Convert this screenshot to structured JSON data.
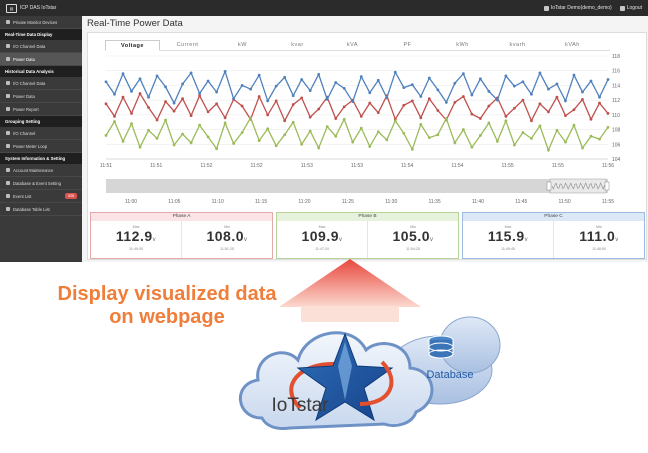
{
  "header": {
    "app_title": "ICP DAS IoTstar",
    "user": "IoTstar Demo(demo_demo)",
    "logout": "Logout"
  },
  "sidebar": {
    "items": [
      {
        "kind": "item",
        "label": "Private Monitor Devices",
        "active": false
      },
      {
        "kind": "head",
        "label": "Real-Time Data Display"
      },
      {
        "kind": "item",
        "label": "I/O Channel Data",
        "active": false
      },
      {
        "kind": "item",
        "label": "Power Data",
        "active": true
      },
      {
        "kind": "head",
        "label": "Historical Data Analysis"
      },
      {
        "kind": "item",
        "label": "I/O Channel Data",
        "active": false
      },
      {
        "kind": "item",
        "label": "Power Data",
        "active": false
      },
      {
        "kind": "item",
        "label": "Power Report",
        "active": false
      },
      {
        "kind": "head",
        "label": "Grouping Setting"
      },
      {
        "kind": "item",
        "label": "I/O Channel",
        "active": false
      },
      {
        "kind": "item",
        "label": "Power Meter Loop",
        "active": false
      },
      {
        "kind": "head",
        "label": "System Information & Setting"
      },
      {
        "kind": "item",
        "label": "Account Maintenance",
        "active": false
      },
      {
        "kind": "item",
        "label": "Database & Event Setting",
        "active": false
      },
      {
        "kind": "item",
        "label": "Event List",
        "active": false,
        "badge": "925"
      },
      {
        "kind": "item",
        "label": "Database Table List",
        "active": false
      }
    ]
  },
  "page": {
    "title": "Real-Time Power Data"
  },
  "tabs": [
    "Voltage",
    "Current",
    "kW",
    "kvar",
    "kVA",
    "PF",
    "kWh",
    "kvarh",
    "kVAh"
  ],
  "chart_data": {
    "type": "line",
    "y_ticks": [
      104,
      106,
      108,
      110,
      112,
      114,
      116,
      118
    ],
    "ylim": [
      104,
      118
    ],
    "x_ticks": [
      "11:51",
      "11:51",
      "11:52",
      "11:52",
      "11:53",
      "11:53",
      "11:54",
      "11:54",
      "11:55",
      "11:55",
      "11:56"
    ],
    "navigator_ticks": [
      "11:00",
      "11:05",
      "11:10",
      "11:15",
      "11:20",
      "11:25",
      "11:30",
      "11:35",
      "11:40",
      "11:45",
      "11:50",
      "11:55"
    ],
    "series": [
      {
        "name": "Phase A",
        "color": "#c0504d",
        "values": [
          111.5,
          109.8,
          112.4,
          110.2,
          112.9,
          111.0,
          109.3,
          111.8,
          110.5,
          112.2,
          109.9,
          112.6,
          110.4,
          111.5,
          109.6,
          112.1,
          111.2,
          109.4,
          112.5,
          110.0,
          111.9,
          109.2,
          111.4,
          112.3,
          109.7,
          110.8,
          112.4,
          109.5,
          111.1,
          112.0,
          109.8,
          111.6,
          110.3,
          112.6,
          109.4,
          111.3,
          111.9,
          109.6,
          112.2,
          110.6,
          109.3,
          111.7,
          112.5,
          110.1,
          109.5,
          111.2,
          112.3,
          109.8,
          110.9,
          112.0,
          109.2,
          111.5,
          110.4,
          112.4,
          109.9,
          110.7,
          112.1,
          109.4,
          111.6,
          110.2
        ]
      },
      {
        "name": "Phase B",
        "color": "#9bbb59",
        "values": [
          107.2,
          109.1,
          106.4,
          108.8,
          105.6,
          107.9,
          106.8,
          109.3,
          105.9,
          107.4,
          106.2,
          108.6,
          107.0,
          105.4,
          108.9,
          106.1,
          107.6,
          109.6,
          106.5,
          108.1,
          105.8,
          107.3,
          109.0,
          106.0,
          107.8,
          105.5,
          108.4,
          107.1,
          109.4,
          106.3,
          108.2,
          105.7,
          107.7,
          106.6,
          109.2,
          107.5,
          105.3,
          108.7,
          106.9,
          107.3,
          109.5,
          106.2,
          108.0,
          105.6,
          107.2,
          108.9,
          106.4,
          109.2,
          105.9,
          107.6,
          106.8,
          108.5,
          105.2,
          107.9,
          106.3,
          108.6,
          105.5,
          107.1,
          106.7,
          108.3
        ]
      },
      {
        "name": "Phase C",
        "color": "#4f81bd",
        "values": [
          114.5,
          112.8,
          115.6,
          113.2,
          114.9,
          112.4,
          115.3,
          113.8,
          111.6,
          114.2,
          115.7,
          112.9,
          114.6,
          113.1,
          115.9,
          112.2,
          114.0,
          113.5,
          115.4,
          111.9,
          113.9,
          115.1,
          112.6,
          114.8,
          113.3,
          115.5,
          112.1,
          114.4,
          113.6,
          111.8,
          115.2,
          113.0,
          114.7,
          112.3,
          115.8,
          113.7,
          114.1,
          112.5,
          115.0,
          113.4,
          111.7,
          114.3,
          115.6,
          112.7,
          114.9,
          113.2,
          112.0,
          115.3,
          113.9,
          114.5,
          112.8,
          115.7,
          113.5,
          114.2,
          111.9,
          115.4,
          113.1,
          114.6,
          112.4,
          114.8
        ]
      }
    ]
  },
  "phases": [
    {
      "name": "Phase A",
      "border": "#e6a9ab",
      "head_bg": "#fbe4e5",
      "max": {
        "label": "Max",
        "value": "112.9",
        "time": "11:49:05"
      },
      "min": {
        "label": "Min",
        "value": "108.0",
        "time": "11:51:25"
      }
    },
    {
      "name": "Phase B",
      "border": "#b7d49a",
      "head_bg": "#e7f2dc",
      "max": {
        "label": "Max",
        "value": "109.9",
        "time": "11:47:24"
      },
      "min": {
        "label": "Min",
        "value": "105.0",
        "time": "11:54:25"
      }
    },
    {
      "name": "Phase C",
      "border": "#9bbbe0",
      "head_bg": "#dce8f6",
      "max": {
        "label": "Max",
        "value": "115.9",
        "time": "11:49:45"
      },
      "min": {
        "label": "Min",
        "value": "111.0",
        "time": "11:48:50"
      }
    }
  ],
  "unit_symbol": "v",
  "caption": {
    "line1": "Display visualized data",
    "line2": "on webpage"
  },
  "cloud": {
    "database_label": "Database",
    "product_name": "IoTstar"
  }
}
